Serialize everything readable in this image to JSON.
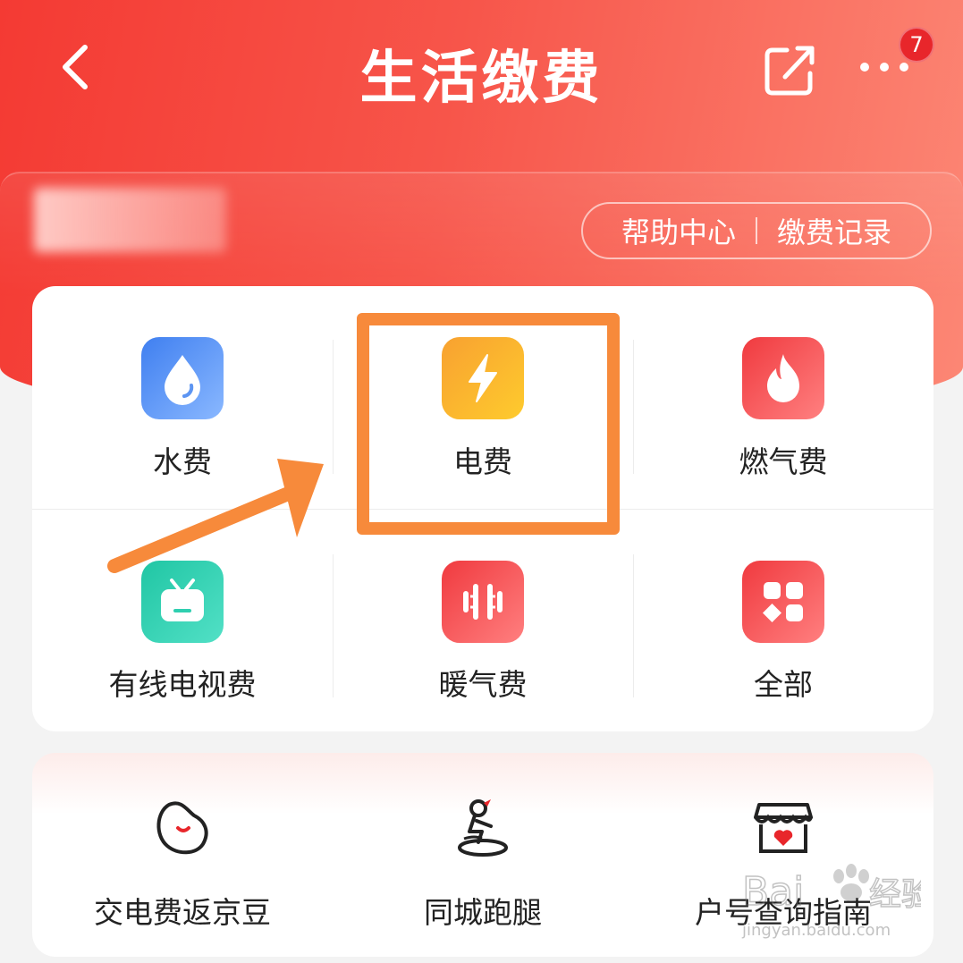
{
  "header": {
    "title": "生活缴费",
    "badge_count": "7",
    "help_label": "帮助中心",
    "records_label": "缴费记录"
  },
  "categories": [
    {
      "label": "水费",
      "icon": "water-drop-icon",
      "color": "#4f8ff0"
    },
    {
      "label": "电费",
      "icon": "lightning-icon",
      "color": "#f9a826"
    },
    {
      "label": "燃气费",
      "icon": "flame-icon",
      "color": "#f04b4f"
    },
    {
      "label": "有线电视费",
      "icon": "tv-icon",
      "color": "#2fcfb0"
    },
    {
      "label": "暖气费",
      "icon": "heater-icon",
      "color": "#f2484c"
    },
    {
      "label": "全部",
      "icon": "grid-icon",
      "color": "#f2484c"
    }
  ],
  "services": [
    {
      "label": "交电费返京豆",
      "icon": "bean-icon"
    },
    {
      "label": "同城跑腿",
      "icon": "courier-icon"
    },
    {
      "label": "户号查询指南",
      "icon": "shop-heart-icon"
    }
  ],
  "watermark": {
    "brand": "Bai",
    "brand_cn": "经验",
    "sub": "jingyan.baidu.com"
  },
  "colors": {
    "header_start": "#f43a33",
    "header_end": "#fc8775",
    "highlight": "#f78a3b"
  }
}
